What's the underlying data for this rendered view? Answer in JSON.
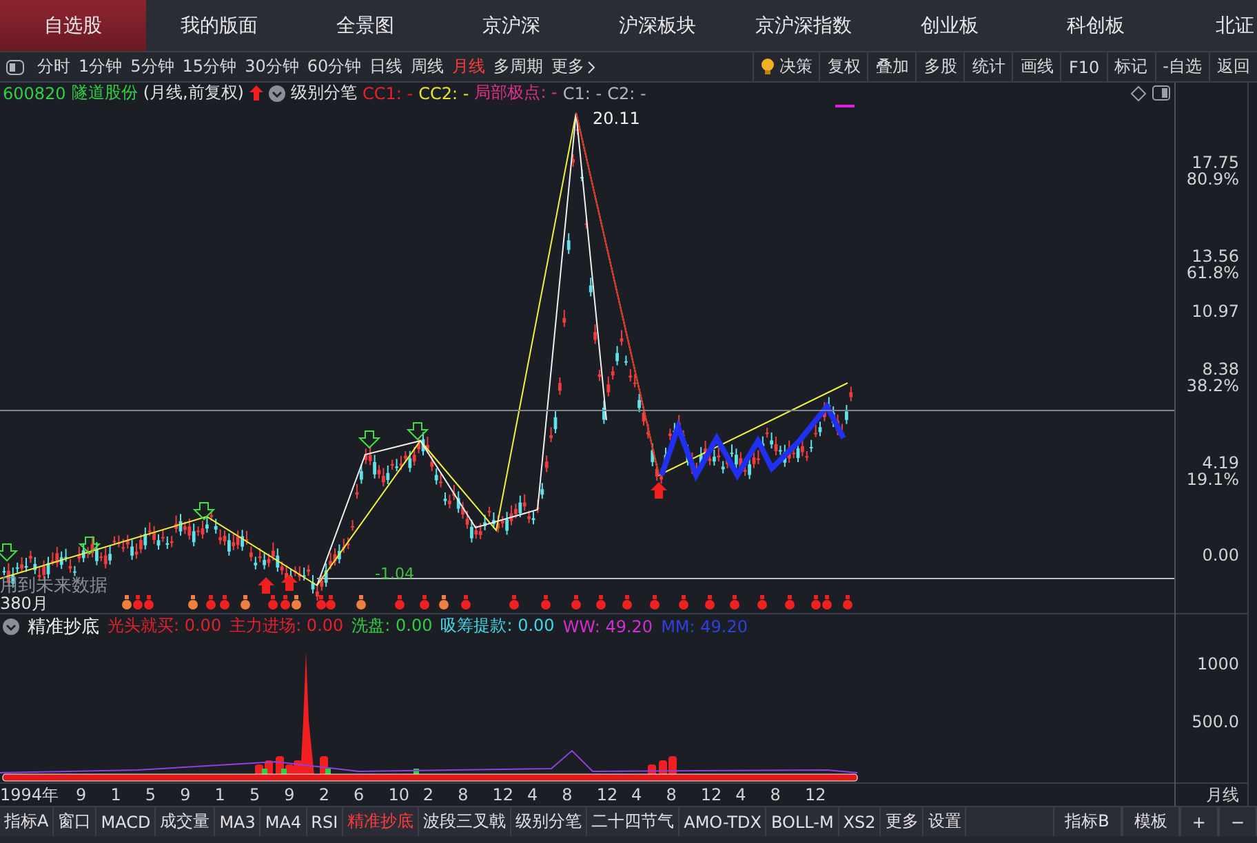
{
  "top_tabs": [
    {
      "label": "自选股",
      "selected": true
    },
    {
      "label": "我的版面",
      "selected": false
    },
    {
      "label": "全景图",
      "selected": false
    },
    {
      "label": "京沪深",
      "selected": false
    },
    {
      "label": "沪深板块",
      "selected": false
    },
    {
      "label": "京沪深指数",
      "selected": false
    },
    {
      "label": "创业板",
      "selected": false
    },
    {
      "label": "科创板",
      "selected": false
    },
    {
      "label": "北证",
      "selected": false
    }
  ],
  "period_toolbar": {
    "periods": [
      {
        "label": "分时",
        "selected": false
      },
      {
        "label": "1分钟",
        "selected": false
      },
      {
        "label": "5分钟",
        "selected": false
      },
      {
        "label": "15分钟",
        "selected": false
      },
      {
        "label": "30分钟",
        "selected": false
      },
      {
        "label": "60分钟",
        "selected": false
      },
      {
        "label": "日线",
        "selected": false
      },
      {
        "label": "周线",
        "selected": false
      },
      {
        "label": "月线",
        "selected": true
      },
      {
        "label": "多周期",
        "selected": false
      }
    ],
    "more": "更多",
    "tools": [
      "决策",
      "复权",
      "叠加",
      "多股",
      "统计",
      "画线",
      "F10",
      "标记",
      "-自选",
      "返回"
    ]
  },
  "info_line": {
    "code": "600820",
    "name": "隧道股份",
    "period": "(月线,前复权)",
    "indicator": "级别分笔",
    "fields": [
      {
        "text": "CC1: -",
        "color": "#e8202a"
      },
      {
        "text": "CC2: -",
        "color": "#e8e030"
      },
      {
        "text": "局部极点: -",
        "color": "#e0308a"
      },
      {
        "text": "C1: -",
        "color": "#b0b4bc"
      },
      {
        "text": "C2: -",
        "color": "#b0b4bc"
      }
    ]
  },
  "main_chart": {
    "peak_label": "20.11",
    "notes": [
      "用到未来数据",
      "380月",
      "-1.04"
    ],
    "axis": [
      {
        "price": "17.75",
        "pct": "80.9%"
      },
      {
        "price": "13.56",
        "pct": "61.8%"
      },
      {
        "price": "10.97"
      },
      {
        "price": "8.38",
        "pct": "38.2%"
      },
      {
        "price": "4.19",
        "pct": "19.1%"
      },
      {
        "price": "0.00"
      }
    ]
  },
  "indicator_line": {
    "name": "精准抄底",
    "fields": [
      {
        "text": "光头就买: 0.00",
        "color": "#e8202a"
      },
      {
        "text": "主力进场: 0.00",
        "color": "#e8202a"
      },
      {
        "text": "洗盘: 0.00",
        "color": "#30d040"
      },
      {
        "text": "吸筹提款: 0.00",
        "color": "#40d8e8"
      },
      {
        "text": "WW: 49.20",
        "color": "#d030d0"
      },
      {
        "text": "MM: 49.20",
        "color": "#3040e0"
      }
    ]
  },
  "sub_chart": {
    "axis": [
      "1000",
      "500.0"
    ]
  },
  "x_axis": {
    "start": "1994年",
    "labels": [
      "9",
      "1",
      "5",
      "9",
      "1",
      "5",
      "9",
      "2",
      "6",
      "10",
      "2",
      "8",
      "12",
      "4",
      "8",
      "12",
      "4",
      "8",
      "12",
      "4",
      "8",
      "12"
    ],
    "period": "月线"
  },
  "bottom_tabs": {
    "left": [
      {
        "label": "指标A",
        "selected": false
      },
      {
        "label": "窗口",
        "selected": false
      },
      {
        "label": "MACD",
        "selected": false
      },
      {
        "label": "成交量",
        "selected": false
      },
      {
        "label": "MA3",
        "selected": false
      },
      {
        "label": "MA4",
        "selected": false
      },
      {
        "label": "RSI",
        "selected": false
      },
      {
        "label": "精准抄底",
        "selected": true
      },
      {
        "label": "波段三叉戟",
        "selected": false
      },
      {
        "label": "级别分笔",
        "selected": false
      },
      {
        "label": "二十四节气",
        "selected": false
      },
      {
        "label": "AMO-TDX",
        "selected": false
      },
      {
        "label": "BOLL-M",
        "selected": false
      },
      {
        "label": "XS2",
        "selected": false
      },
      {
        "label": "更多",
        "selected": false
      },
      {
        "label": "设置",
        "selected": false
      }
    ],
    "right": [
      "指标B",
      "模板",
      "+",
      "−"
    ]
  }
}
